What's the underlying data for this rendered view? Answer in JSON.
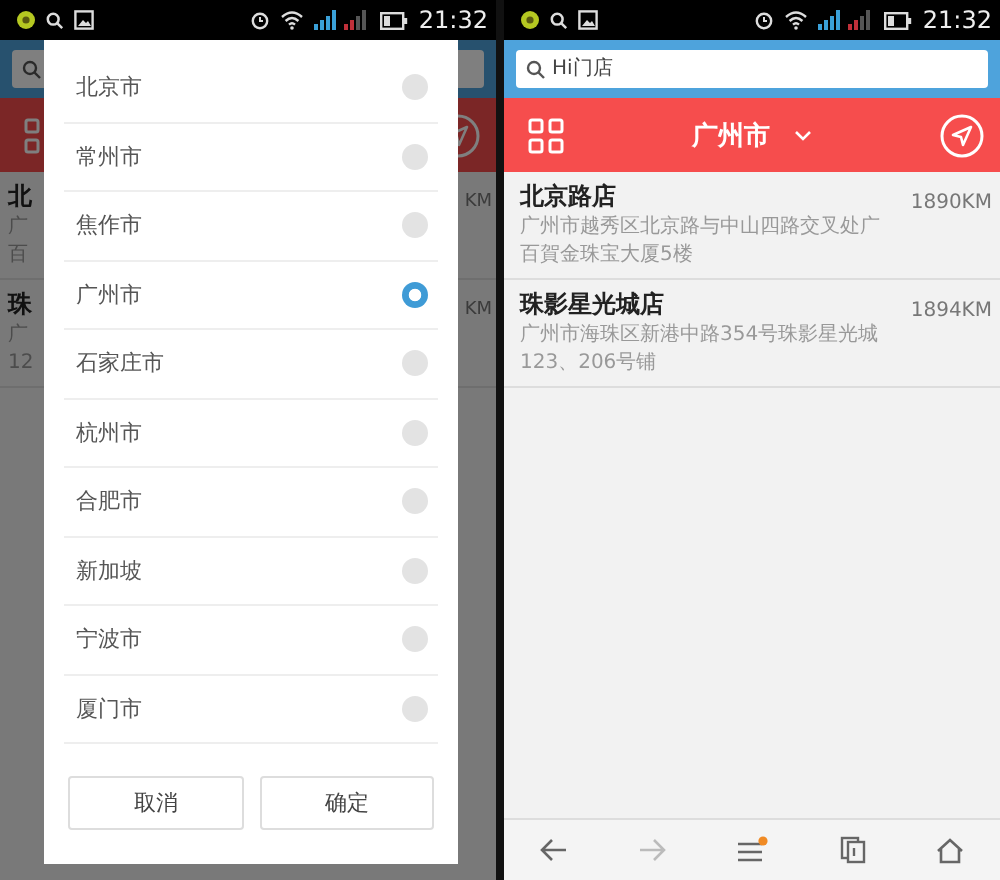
{
  "screens": [
    {
      "status_bar": {
        "time": "21:32"
      },
      "stores": [
        {
          "name": "北",
          "address": [
            "广",
            "百"
          ],
          "distance": "KM"
        },
        {
          "name": "珠",
          "address": [
            "广",
            "12"
          ],
          "distance": "KM"
        }
      ],
      "dialog": {
        "options": [
          {
            "label": "北京市",
            "selected": false
          },
          {
            "label": "常州市",
            "selected": false
          },
          {
            "label": "焦作市",
            "selected": false
          },
          {
            "label": "广州市",
            "selected": true
          },
          {
            "label": "石家庄市",
            "selected": false
          },
          {
            "label": "杭州市",
            "selected": false
          },
          {
            "label": "合肥市",
            "selected": false
          },
          {
            "label": "新加坡",
            "selected": false
          },
          {
            "label": "宁波市",
            "selected": false
          },
          {
            "label": "厦门市",
            "selected": false
          }
        ],
        "buttons": [
          "取消",
          "确定"
        ]
      }
    },
    {
      "status_bar": {
        "time": "21:32"
      },
      "search": {
        "placeholder": "Hi门店"
      },
      "header": {
        "city": "广州市"
      },
      "stores": [
        {
          "name": "北京路店",
          "address": [
            "广州市越秀区北京路与中山四路交叉处广",
            "百賀金珠宝大厦5楼"
          ],
          "distance": "1890KM"
        },
        {
          "name": "珠影星光城店",
          "address": [
            "广州市海珠区新港中路354号珠影星光城",
            "123、206号铺"
          ],
          "distance": "1894KM"
        }
      ],
      "nav": {
        "badge": true
      }
    }
  ]
}
